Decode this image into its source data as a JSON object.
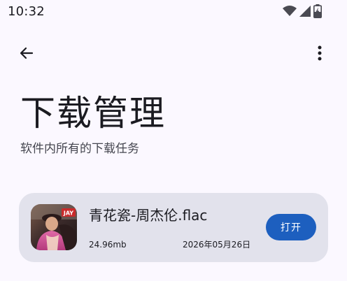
{
  "status_bar": {
    "time": "10:32",
    "icons": [
      "wifi-icon",
      "cellular-signal-icon",
      "battery-charging-icon"
    ]
  },
  "top_bar": {
    "back_icon": "arrow-back-icon",
    "more_icon": "more-vert-icon"
  },
  "header": {
    "title": "下载管理",
    "subtitle": "软件内所有的下载任务"
  },
  "downloads": [
    {
      "file_name": "青花瓷-周杰伦.flac",
      "size": "24.96mb",
      "date": "2026年05月26日",
      "action_label": "打开",
      "cover_badge": "JAY"
    }
  ],
  "colors": {
    "background": "#fbf8ff",
    "card": "#e2e2ec",
    "primary_button": "#1d5fbf",
    "text": "#1b1b21"
  }
}
